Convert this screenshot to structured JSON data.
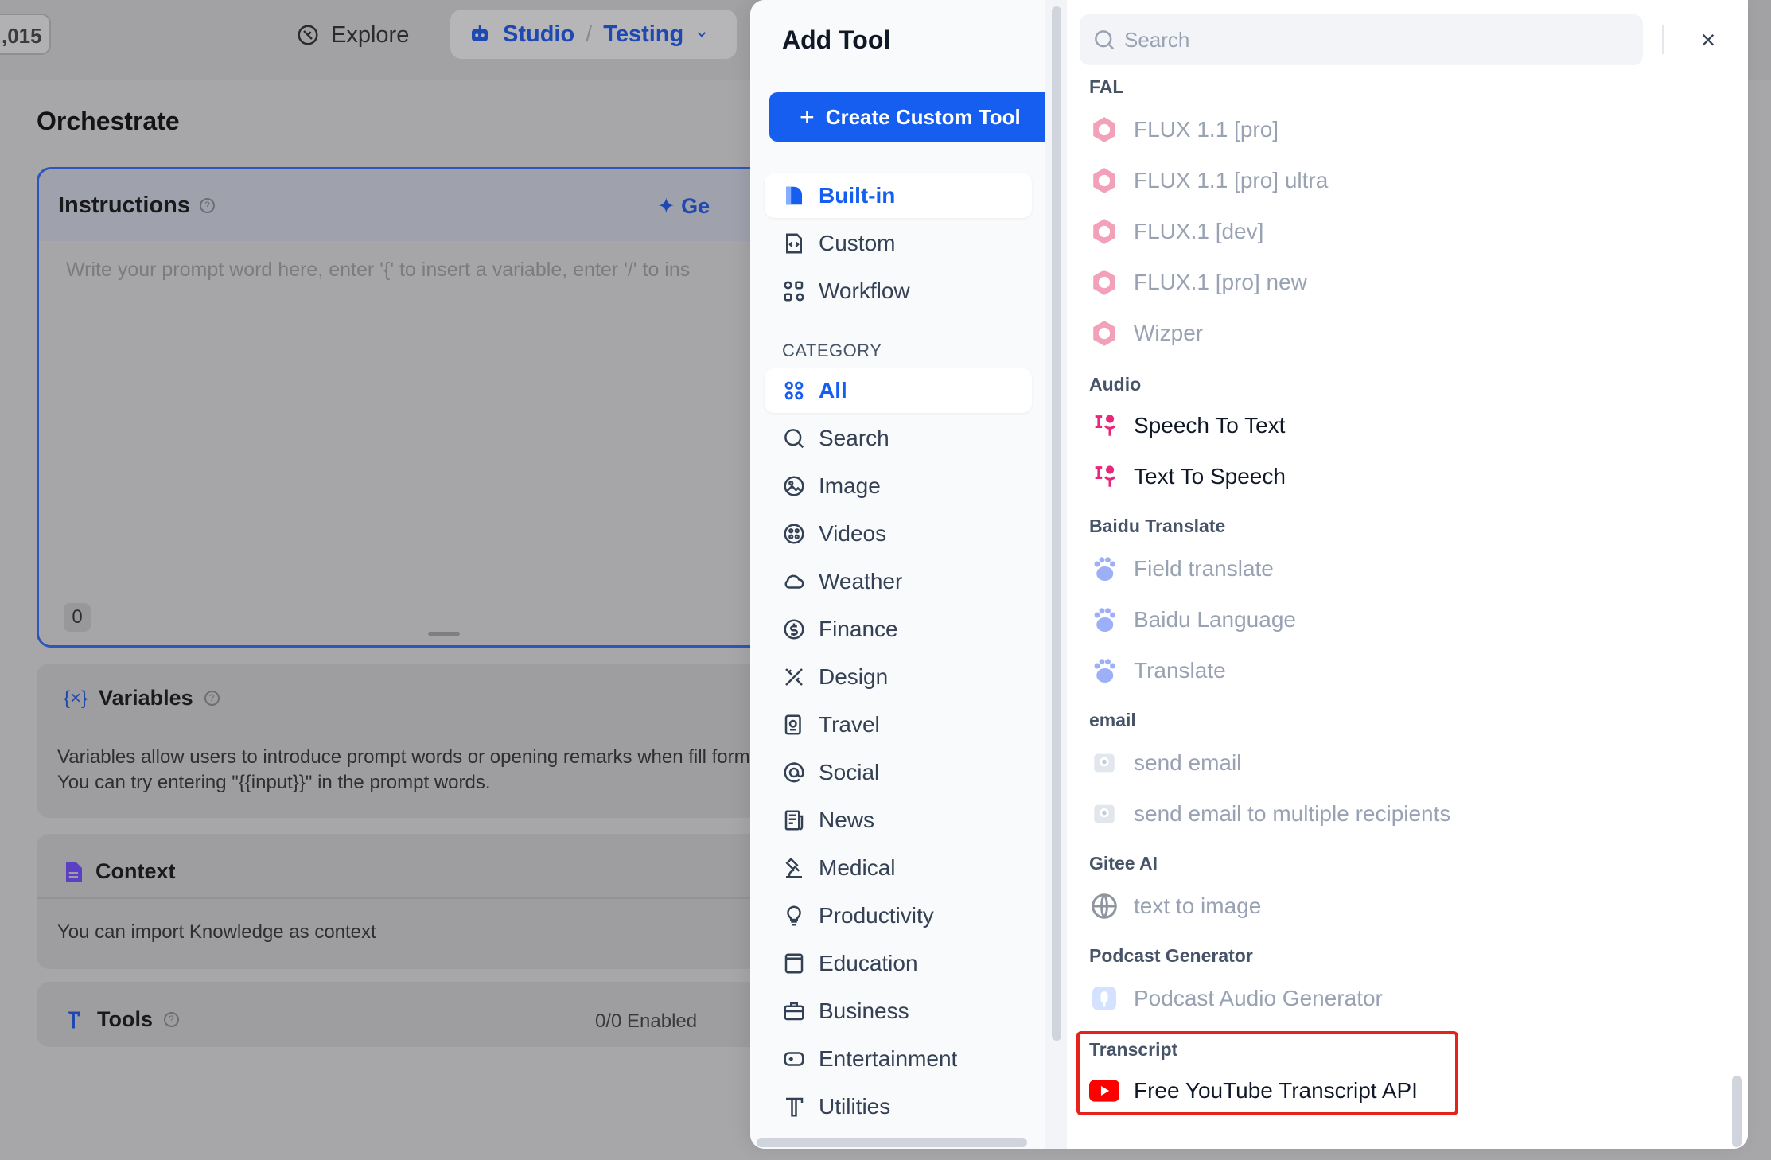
{
  "background": {
    "credit_text": ",015",
    "explore_label": "Explore",
    "studio_label": "Studio",
    "breadcrumb_sep": "/",
    "app_name": "Testing",
    "page_title": "Orchestrate",
    "instructions": {
      "title": "Instructions",
      "generate_label": "Ge",
      "placeholder": "Write your prompt word here, enter '{' to insert a variable, enter '/' to ins",
      "char_count": "0"
    },
    "variables": {
      "title": "Variables",
      "description": "Variables allow users to introduce prompt words or opening remarks when fill forms. You can try entering \"{{input}}\" in the prompt words."
    },
    "context": {
      "title": "Context",
      "description": "You can import Knowledge as context"
    },
    "tools": {
      "title": "Tools",
      "enabled": "0/0 Enabled"
    }
  },
  "modal": {
    "title": "Add Tool",
    "create_custom_tool": "Create Custom Tool",
    "provider_tabs": [
      {
        "label": "Built-in",
        "icon": "builtin-icon"
      },
      {
        "label": "Custom",
        "icon": "custom-icon"
      },
      {
        "label": "Workflow",
        "icon": "workflow-icon"
      }
    ],
    "category_heading": "CATEGORY",
    "categories": [
      {
        "label": "All",
        "icon": "grid-icon"
      },
      {
        "label": "Search",
        "icon": "search-icon"
      },
      {
        "label": "Image",
        "icon": "image-icon"
      },
      {
        "label": "Videos",
        "icon": "videos-icon"
      },
      {
        "label": "Weather",
        "icon": "weather-icon"
      },
      {
        "label": "Finance",
        "icon": "finance-icon"
      },
      {
        "label": "Design",
        "icon": "design-icon"
      },
      {
        "label": "Travel",
        "icon": "travel-icon"
      },
      {
        "label": "Social",
        "icon": "social-icon"
      },
      {
        "label": "News",
        "icon": "news-icon"
      },
      {
        "label": "Medical",
        "icon": "medical-icon"
      },
      {
        "label": "Productivity",
        "icon": "productivity-icon"
      },
      {
        "label": "Education",
        "icon": "education-icon"
      },
      {
        "label": "Business",
        "icon": "business-icon"
      },
      {
        "label": "Entertainment",
        "icon": "entertainment-icon"
      },
      {
        "label": "Utilities",
        "icon": "utilities-icon"
      }
    ],
    "search_placeholder": "Search",
    "close_label": "×",
    "groups": [
      {
        "name": "FAL",
        "tools": [
          "FLUX 1.1 [pro]",
          "FLUX 1.1 [pro] ultra",
          "FLUX.1 [dev]",
          "FLUX.1 [pro] new",
          "Wizper"
        ]
      },
      {
        "name": "Audio",
        "tools": [
          "Speech To Text",
          "Text To Speech"
        ]
      },
      {
        "name": "Baidu Translate",
        "tools": [
          "Field translate",
          "Baidu Language",
          "Translate"
        ]
      },
      {
        "name": "email",
        "tools": [
          "send email",
          "send email to multiple recipients"
        ]
      },
      {
        "name": "Gitee AI",
        "tools": [
          "text to image"
        ]
      },
      {
        "name": "Podcast Generator",
        "tools": [
          "Podcast Audio Generator"
        ]
      },
      {
        "name": "Transcript",
        "tools": [
          "Free YouTube Transcript API"
        ]
      }
    ]
  },
  "colors": {
    "accent": "#155eef",
    "highlight": "#e5231b",
    "fal": "#f2a7b8",
    "audio": "#e8267a",
    "baidu": "#4e6ef2",
    "youtube": "#ff0000"
  }
}
